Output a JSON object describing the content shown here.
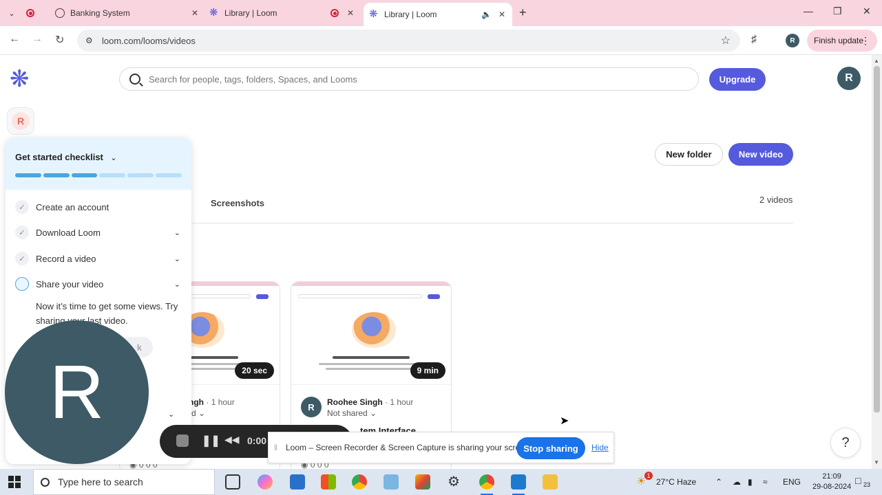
{
  "browser": {
    "tabs": [
      {
        "title": "",
        "icon": "record-icon"
      },
      {
        "title": "Banking System",
        "icon": "globe-icon"
      },
      {
        "title": "Library | Loom",
        "icon": "loom-icon"
      },
      {
        "title": "Library | Loom",
        "icon": "loom-icon",
        "active": true
      }
    ],
    "url": "loom.com/looms/videos",
    "profile_initial": "R",
    "finish_update_label": "Finish update"
  },
  "app": {
    "logo_icon": "loom-logo-icon",
    "workspace_initial": "R",
    "search_placeholder": "Search for people, tags, folders, Spaces, and Looms",
    "upgrade_label": "Upgrade",
    "user_initial": "R",
    "new_folder_label": "New folder",
    "new_video_label": "New video",
    "tabs": {
      "videos_partial": "e",
      "screenshots": "Screenshots"
    },
    "video_count": "2 videos",
    "accent_color": "#565adc"
  },
  "checklist": {
    "title": "Get started checklist",
    "progress_total": 6,
    "progress_done": 3,
    "items": [
      {
        "label": "Create an account",
        "done": true
      },
      {
        "label": "Download Loom",
        "done": true
      },
      {
        "label": "Record a video",
        "done": true
      },
      {
        "label": "Share your video",
        "done": false
      }
    ],
    "description": "Now it’s time to get some views. Try sharing your last video.",
    "partial_button": "k"
  },
  "videos": [
    {
      "duration": "20 sec",
      "author_partial": "ngh",
      "time": "1 hour",
      "share_partial": "d",
      "stats": "0   0   0"
    },
    {
      "duration": "9 min",
      "author_initial": "R",
      "author": "Roohee Singh",
      "time": "1 hour",
      "share": "Not shared",
      "title_partial": "tem Interface",
      "stats": "0   0   0"
    }
  ],
  "camera_bubble_initial": "R",
  "recorder": {
    "timer": "0:00"
  },
  "share_banner": {
    "message": "Loom – Screen Recorder & Screen Capture is sharing your screen.",
    "stop_label": "Stop sharing",
    "hide_label": "Hide"
  },
  "taskbar": {
    "search_placeholder": "Type here to search",
    "weather": "27°C  Haze",
    "language": "ENG",
    "time": "21:09",
    "date": "29-08-2024",
    "notification_count": "23",
    "weather_badge": "1"
  }
}
